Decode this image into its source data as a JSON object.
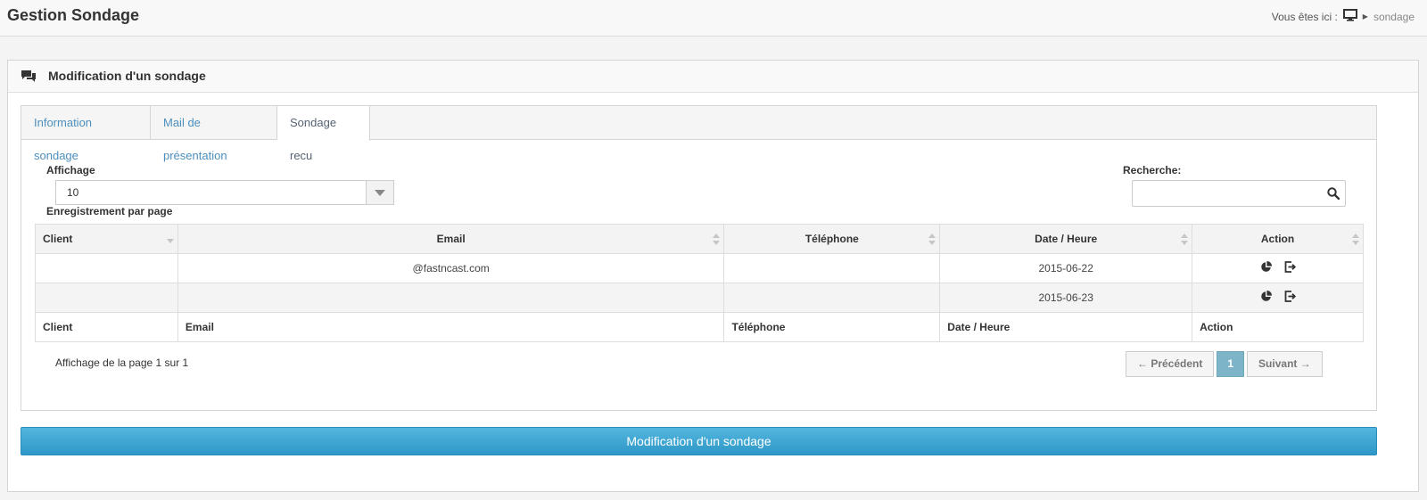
{
  "header": {
    "title": "Gestion Sondage",
    "breadcrumb_prefix": "Vous êtes ici :",
    "breadcrumb_home_icon": "monitor-icon",
    "breadcrumb_current": "sondage"
  },
  "box": {
    "icon": "chat-icon",
    "title": "Modification d'un sondage"
  },
  "tabs": [
    {
      "label": "Information sondage",
      "active": false
    },
    {
      "label": "Mail de présentation",
      "active": false
    },
    {
      "label": "Sondage recu",
      "active": true
    }
  ],
  "controls": {
    "length_label": "Affichage",
    "length_value": "10",
    "length_suffix": "Enregistrement par page",
    "search_label": "Recherche:",
    "search_value": ""
  },
  "table": {
    "columns": [
      "Client",
      "Email",
      "Téléphone",
      "Date / Heure",
      "Action"
    ],
    "rows": [
      {
        "client": "",
        "email": "@fastncast.com",
        "telephone": "",
        "date": "2015-06-22"
      },
      {
        "client": "",
        "email": "",
        "telephone": "",
        "date": "2015-06-23"
      }
    ],
    "action_icons": [
      "pie-chart-icon",
      "sign-out-icon"
    ],
    "footer_columns": [
      "Client",
      "Email",
      "Téléphone",
      "Date / Heure",
      "Action"
    ]
  },
  "pagination": {
    "info": "Affichage de la page 1 sur 1",
    "prev": "← Précédent",
    "current": "1",
    "next": "Suivant →"
  },
  "submit_label": "Modification d'un sondage",
  "colors": {
    "accent": "#3ea7d3",
    "link": "#4c8fbd",
    "page_active": "#7db4c8"
  }
}
